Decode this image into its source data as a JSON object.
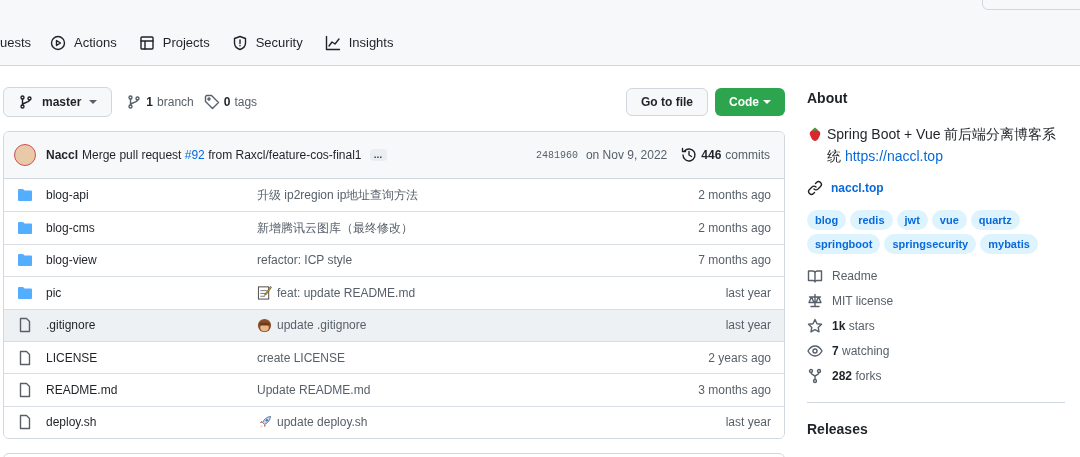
{
  "repo_nav": {
    "tabs": [
      {
        "label": "uests",
        "kind": "pr",
        "selected": false
      },
      {
        "label": "Actions",
        "kind": "actions",
        "selected": false
      },
      {
        "label": "Projects",
        "kind": "projects",
        "selected": false
      },
      {
        "label": "Security",
        "kind": "security",
        "selected": false
      },
      {
        "label": "Insights",
        "kind": "insights",
        "selected": false
      }
    ]
  },
  "toolbar": {
    "branch": "master",
    "branches_count": "1",
    "branches_label": "branch",
    "tags_count": "0",
    "tags_label": "tags",
    "go_to_file": "Go to file",
    "code": "Code"
  },
  "latest_commit": {
    "author": "Naccl",
    "message_start": "Merge pull request",
    "pr_link": "#92",
    "message_end": "from Raxcl/feature-cos-final1",
    "ellipsis": "…",
    "sha": "2481960",
    "date": "on Nov 9, 2022",
    "commits_count": "446",
    "commits_label": "commits"
  },
  "files": [
    {
      "name": "blog-api",
      "kind": "folder",
      "message": "升级 ip2region ip地址查询方法",
      "age": "2 months ago",
      "hovered": false
    },
    {
      "name": "blog-cms",
      "kind": "folder",
      "message": "新增腾讯云图库（最终修改）",
      "age": "2 months ago",
      "hovered": false
    },
    {
      "name": "blog-view",
      "kind": "folder",
      "message": "refactor: ICP style",
      "age": "7 months ago",
      "hovered": false
    },
    {
      "name": "pic",
      "kind": "folder",
      "commit_emoji": {
        "kind": "memo"
      },
      "message": "feat: update README.md",
      "age": "last year",
      "hovered": false
    },
    {
      "name": ".gitignore",
      "kind": "file",
      "commit_emoji": {
        "kind": "monkey"
      },
      "message": "update .gitignore",
      "age": "last year",
      "hovered": true
    },
    {
      "name": "LICENSE",
      "kind": "file",
      "message": "create LICENSE",
      "age": "2 years ago",
      "hovered": false
    },
    {
      "name": "README.md",
      "kind": "file",
      "message": "Update README.md",
      "age": "3 months ago",
      "hovered": false
    },
    {
      "name": "deploy.sh",
      "kind": "file",
      "commit_emoji": {
        "kind": "rocket"
      },
      "message": "update deploy.sh",
      "age": "last year",
      "hovered": false
    }
  ],
  "about": {
    "title": "About",
    "description": "Spring Boot + Vue 前后端分离博客系统",
    "description_link": "https://naccl.top",
    "website": "naccl.top",
    "topics": [
      "blog",
      "redis",
      "jwt",
      "vue",
      "quartz",
      "springboot",
      "springsecurity",
      "mybatis"
    ],
    "stats": [
      {
        "kind": "readme",
        "label": "Readme"
      },
      {
        "kind": "license",
        "label": "MIT license"
      },
      {
        "kind": "stars",
        "count": "1k",
        "label": "stars"
      },
      {
        "kind": "watching",
        "count": "7",
        "label": "watching"
      },
      {
        "kind": "forks",
        "count": "282",
        "label": "forks"
      }
    ],
    "releases_title": "Releases"
  }
}
